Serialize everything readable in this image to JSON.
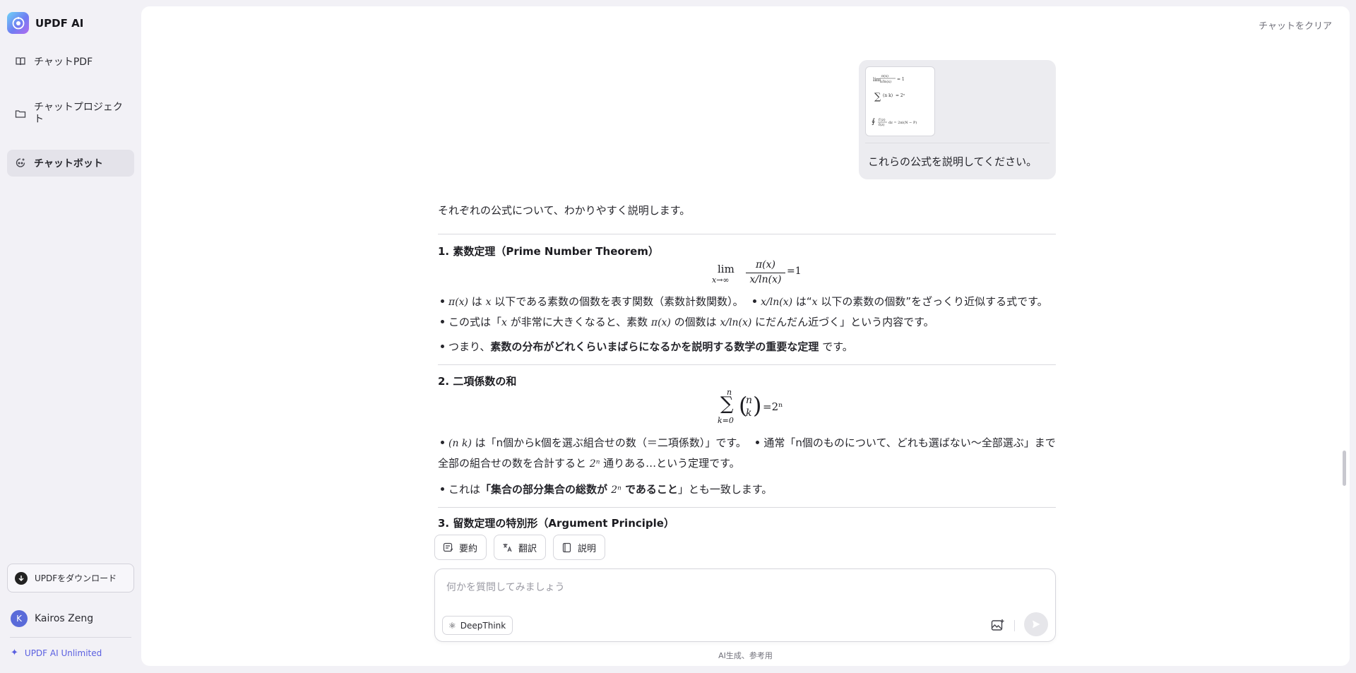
{
  "app": {
    "name": "UPDF AI"
  },
  "sidebar": {
    "items": [
      {
        "label": "チャットPDF",
        "icon": "book-icon"
      },
      {
        "label": "チャットプロジェクト",
        "icon": "folder-icon"
      },
      {
        "label": "チャットボット",
        "icon": "bot-icon",
        "active": true
      }
    ],
    "download_label": "UPDFをダウンロード",
    "user": {
      "initial": "K",
      "name": "Kairos Zeng"
    },
    "plan_label": "UPDF AI Unlimited"
  },
  "header": {
    "clear_label": "チャットをクリア"
  },
  "chat": {
    "user_message": "これらの公式を説明してください。",
    "answer": {
      "intro": "それぞれの公式について、わかりやすく説明します。",
      "s1": {
        "title": "1. 素数定理（Prime Number Theorem）",
        "p1_a": " は ",
        "p1_b": " 以下である素数の個数を表す関数（素数計数関数）。",
        "p1_c": " は“",
        "p1_d": " 以下の素数の個数”をざっくり近似する式です。",
        "p1_e": "この式は「",
        "p1_f": " が非常に大きくなると、素数 ",
        "p1_g": " の個数は ",
        "p1_h": " にだんだん近づく」という内容です。",
        "p2_a": "つまり、",
        "p2_bold": "素数の分布がどれくらいまばらになるかを説明する数学の重要な定理",
        "p2_c": " です。"
      },
      "s2": {
        "title": "2. 二項係数の和",
        "p1_a": " は「n個からk個を選ぶ組合せの数（＝二項係数）」です。",
        "p1_b": "通常「n個のものについて、どれも選ばない〜全部選ぶ」まで全部の組合せの数を合計すると ",
        "p1_c": " 通りある…という定理です。",
        "p2_a": "これは",
        "p2_bold1": "「集合の部分集合の総数が ",
        "p2_bold2": " であること",
        "p2_c": "」とも一致します。"
      },
      "s3": {
        "title": "3. 留数定理の特別形（Argument Principle）"
      }
    }
  },
  "quick_actions": [
    {
      "label": "要約",
      "icon": "summarize-icon"
    },
    {
      "label": "翻訳",
      "icon": "translate-icon"
    },
    {
      "label": "説明",
      "icon": "explain-icon"
    }
  ],
  "composer": {
    "placeholder": "何かを質問してみましょう",
    "deepthink_label": "DeepThink"
  },
  "footer_note": "AI生成、参考用",
  "math": {
    "pi_x": "π(x)",
    "x": "x",
    "x_over_ln": "x/ln(x)",
    "two_n": "2ⁿ",
    "lim": "lim",
    "lim_sub": "x→∞",
    "frac_num": "π(x)",
    "frac_den": "x/ln(x)",
    "eq_one": "=1",
    "sigma": "∑",
    "sum_top": "n",
    "sum_bottom": "k=0",
    "binom_n": "n",
    "binom_k": "k",
    "eq_two_n": "=2ⁿ"
  }
}
